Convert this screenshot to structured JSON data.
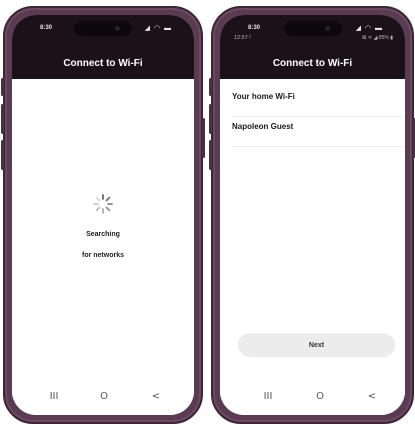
{
  "left_phone": {
    "status": {
      "time": "8:30",
      "icons": "◢ ◠ ▬"
    },
    "header": {
      "title": "Connect to Wi-Fi"
    },
    "searching": {
      "line1": "Searching",
      "line2": "for networks"
    },
    "nav": {
      "recents": "III",
      "home": "O",
      "back": "<"
    }
  },
  "right_phone": {
    "status": {
      "time": "8:30",
      "time_secondary": "12:57  !",
      "icons": "◢ ◠ ▬",
      "icons_secondary": "⊠ ᯤ ◢ 85% ▮"
    },
    "header": {
      "title": "Connect to Wi-Fi"
    },
    "networks": [
      {
        "name": "Your home Wi-Fi"
      },
      {
        "name": "Napoleon Guest"
      }
    ],
    "next_label": "Next",
    "nav": {
      "recents": "III",
      "home": "O",
      "back": "<"
    }
  },
  "colors": {
    "frame": "#5a3b52",
    "header_bg": "#1b1219",
    "button_bg": "#ececec"
  }
}
